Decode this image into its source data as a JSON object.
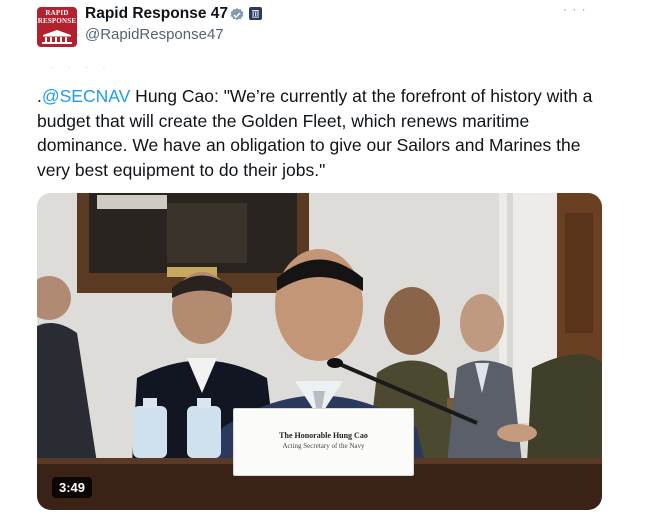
{
  "account": {
    "avatar_brand": "RAPID RESPONSE",
    "display_name": "Rapid Response 47",
    "handle": "@RapidResponse47",
    "verified_icon": "verified-badge-icon",
    "affiliation_icon": "government-affiliation-icon"
  },
  "tweet": {
    "prefix": ".",
    "mention": "@SECNAV",
    "text": " Hung Cao: \"We’re currently at the forefront of history with a budget that will create the Golden Fleet, which renews maritime dominance. We have an obligation to give our Sailors and Marines the very best equipment to do their jobs.\""
  },
  "media": {
    "type": "video",
    "duration": "3:49",
    "nameplate_line1": "The Honorable Hung Cao",
    "nameplate_line2": "Acting Secretary of the Navy"
  },
  "colors": {
    "accent": "#1d9bf0",
    "brand": "#b3202e",
    "text": "#0f1419",
    "muted": "#536471"
  }
}
